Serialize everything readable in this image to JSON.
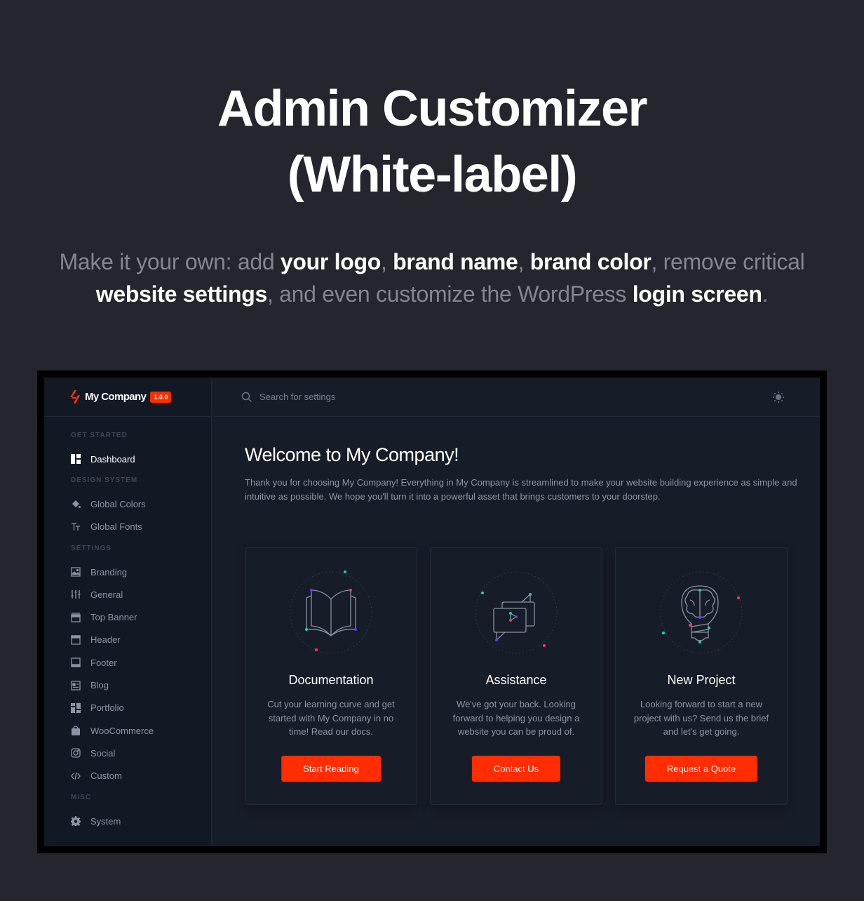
{
  "hero": {
    "title_line1": "Admin Customizer",
    "title_line2": "(White-label)",
    "subtitle": [
      {
        "text": "Make it your own: add ",
        "bold": false
      },
      {
        "text": "your logo",
        "bold": true
      },
      {
        "text": ", ",
        "bold": false
      },
      {
        "text": "brand name",
        "bold": true
      },
      {
        "text": ", ",
        "bold": false
      },
      {
        "text": "brand color",
        "bold": true
      },
      {
        "text": ", remove critical ",
        "bold": false
      },
      {
        "text": "website settings",
        "bold": true
      },
      {
        "text": ", and even customize the WordPress ",
        "bold": false
      },
      {
        "text": "login screen",
        "bold": true
      },
      {
        "text": ".",
        "bold": false
      }
    ]
  },
  "app": {
    "brand": {
      "name": "My Company",
      "version": "1.0.0",
      "logo_icon": "bolt-slashes-icon"
    },
    "colors": {
      "accent": "#ff2d00",
      "background": "#171c29",
      "sidebar": "#131825",
      "teal": "#1fd1b0",
      "pink": "#ff3366",
      "purple": "#6a3cff"
    },
    "search": {
      "placeholder": "Search for settings"
    },
    "theme_toggle_icon": "sun-icon",
    "sidebar": {
      "sections": [
        {
          "title": "GET STARTED",
          "items": [
            {
              "label": "Dashboard",
              "icon": "dashboard-icon",
              "active": true
            }
          ]
        },
        {
          "title": "DESIGN SYSTEM",
          "items": [
            {
              "label": "Global Colors",
              "icon": "paint-bucket-icon"
            },
            {
              "label": "Global Fonts",
              "icon": "text-size-icon"
            }
          ]
        },
        {
          "title": "SETTINGS",
          "items": [
            {
              "label": "Branding",
              "icon": "image-icon"
            },
            {
              "label": "General",
              "icon": "sliders-icon"
            },
            {
              "label": "Top Banner",
              "icon": "top-banner-icon"
            },
            {
              "label": "Header",
              "icon": "header-icon"
            },
            {
              "label": "Footer",
              "icon": "footer-icon"
            },
            {
              "label": "Blog",
              "icon": "blog-icon"
            },
            {
              "label": "Portfolio",
              "icon": "portfolio-icon"
            },
            {
              "label": "WooCommerce",
              "icon": "shopping-bag-icon"
            },
            {
              "label": "Social",
              "icon": "instagram-icon"
            },
            {
              "label": "Custom",
              "icon": "code-icon"
            }
          ]
        },
        {
          "title": "MISC",
          "items": [
            {
              "label": "System",
              "icon": "gear-icon"
            }
          ]
        }
      ]
    },
    "main": {
      "welcome": "Welcome to My Company!",
      "intro": "Thank you for choosing My Company! Everything in My Company is streamlined to make your website building experience as simple and intuitive as possible. We hope you'll turn it into a powerful asset that brings customers to your doorstep.",
      "cards": [
        {
          "title": "Documentation",
          "desc": "Cut your learning curve and get started with My Company in no time! Read our docs.",
          "button": "Start Reading",
          "illustration": "open-book-icon"
        },
        {
          "title": "Assistance",
          "desc": "We've got your back. Looking forward to helping you design a website you can be proud of.",
          "button": "Contact Us",
          "illustration": "chat-bubbles-icon"
        },
        {
          "title": "New Project",
          "desc": "Looking forward to start a new project with us? Send us the brief and let's get going.",
          "button": "Request a Quote",
          "illustration": "lightbulb-brain-icon"
        }
      ]
    }
  }
}
